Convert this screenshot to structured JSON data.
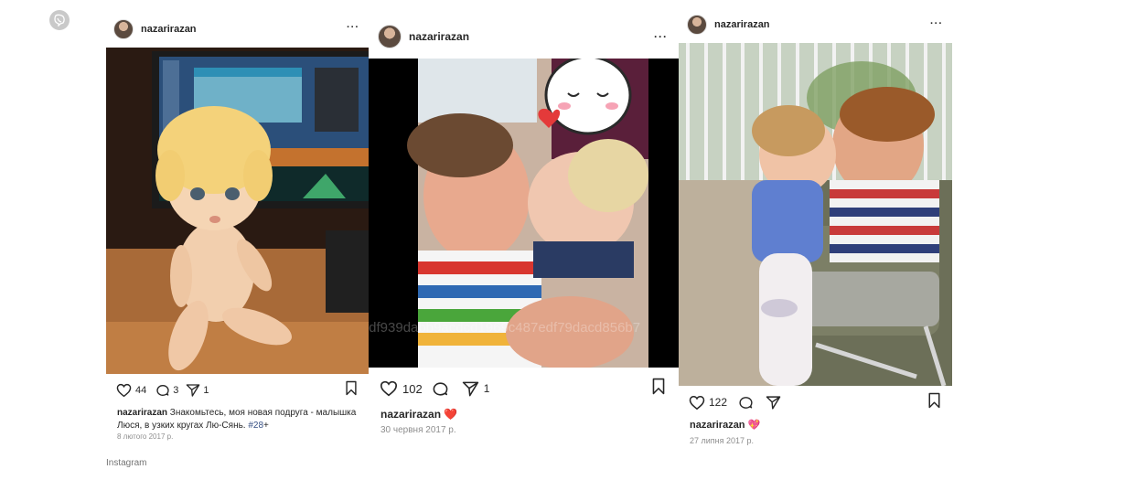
{
  "page": {
    "footer_label": "Instagram"
  },
  "icons": {
    "corner_badge": "viber-icon",
    "like": "heart-outline-icon",
    "comment": "comment-icon",
    "share": "paper-plane-icon",
    "save": "bookmark-icon",
    "more": "more-dots-icon"
  },
  "colors": {
    "hashtag": "#385185",
    "muted": "#8e8e8e",
    "heart_red": "#e0245e",
    "heart_pink": "#f05a9f"
  },
  "posts": [
    {
      "username": "nazarirazan",
      "more": "···",
      "likes": "44",
      "comments": "3",
      "shares": "1",
      "caption_user": "nazarirazan",
      "caption_text": " Знакомьтесь, моя новая подруга - малышка Люся, в узких кругах Лю-Сянь. ",
      "caption_hashtag": "#28",
      "caption_suffix": "+",
      "date": "8 лютого 2017 р."
    },
    {
      "username": "nazarirazan",
      "more": "···",
      "likes": "102",
      "comments": "",
      "shares": "1",
      "caption_user": "nazarirazan",
      "caption_emoji": "❤️",
      "watermark": "fdf939dabb9acdcd1969c487edf79dacd856b7",
      "date": "30 червня 2017 р."
    },
    {
      "username": "nazarirazan",
      "more": "···",
      "likes": "122",
      "comments": "",
      "shares": "",
      "caption_user": "nazarirazan",
      "caption_emoji": "💖",
      "date": "27 липня 2017 р."
    }
  ]
}
